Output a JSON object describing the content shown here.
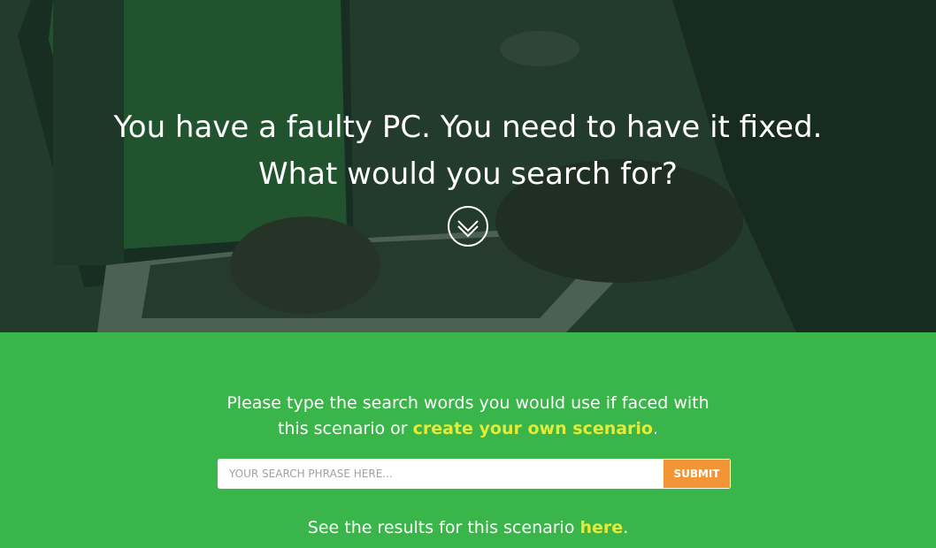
{
  "hero": {
    "headline_line1": "You have a faulty PC. You need to have it fixed.",
    "headline_line2": "What would you search for?",
    "scroll_icon": "chevron-down-circle-icon"
  },
  "panel": {
    "prompt_text": "Please type the search words you would use if faced with",
    "prompt_text2": "this scenario or",
    "create_link_label": "create your own scenario",
    "prompt_end": ".",
    "search_placeholder": "YOUR SEARCH PHRASE HERE...",
    "submit_label": "SUBMIT",
    "results_text": "See the results for this scenario",
    "results_link_label": "here",
    "results_end": "."
  },
  "colors": {
    "panel_green": "#3ab54a",
    "link_yellow": "#e3eb3a",
    "submit_orange": "#f19536",
    "hero_tint": "#1c3826"
  }
}
